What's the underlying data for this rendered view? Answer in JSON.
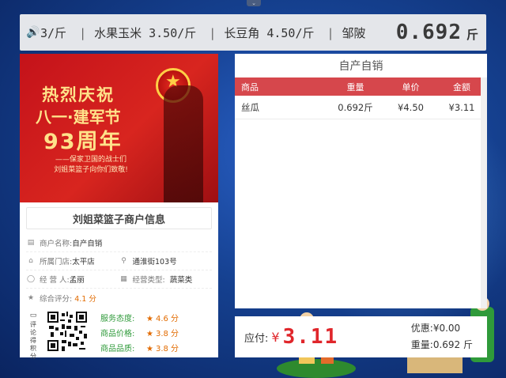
{
  "ticker": {
    "items": [
      "3/斤",
      "水果玉米 3.50/斤",
      "长豆角 4.50/斤",
      "邹陂"
    ],
    "weight": "0.692",
    "weight_unit": "斤"
  },
  "banner": {
    "line1": "热烈庆祝",
    "line2": "八一·建军节",
    "line3": "93周年",
    "line4": "——保家卫国的战士们",
    "line5": "刘姐菜篮子向你们致敬!"
  },
  "shop": {
    "title": "刘姐菜篮子商户信息",
    "name_label": "商户名称:",
    "name_value": "自产自销",
    "store_label": "所属门店:",
    "store_value": "太平店",
    "address_value": "通淮街103号",
    "operator_label": "经 营 人:",
    "operator_value": "孟丽",
    "category_label": "经营类型:",
    "category_value": "蔬菜类",
    "overall_label": "综合评分:",
    "overall_value": "4.1 分",
    "qr_label": "评论得积分",
    "scores": [
      {
        "label": "服务态度:",
        "value": "4.6 分"
      },
      {
        "label": "商品价格:",
        "value": "3.8 分"
      },
      {
        "label": "商品品质:",
        "value": "3.8 分"
      }
    ]
  },
  "sales": {
    "title": "自产自销",
    "headers": [
      "商品",
      "重量",
      "单价",
      "金额"
    ],
    "rows": [
      {
        "item": "丝瓜",
        "weight": "0.692斤",
        "price": "¥4.50",
        "amount": "¥3.11"
      }
    ]
  },
  "payment": {
    "due_label": "应付:",
    "currency": "¥",
    "due_amount": "3.11",
    "discount_line": "优惠:¥0.00",
    "weight_line": "重量:0.692 斤"
  },
  "colors": {
    "accent_red": "#d6474c",
    "amount_red": "#e0262b",
    "score_green": "#2f9a3a",
    "score_orange": "#e26b00"
  }
}
